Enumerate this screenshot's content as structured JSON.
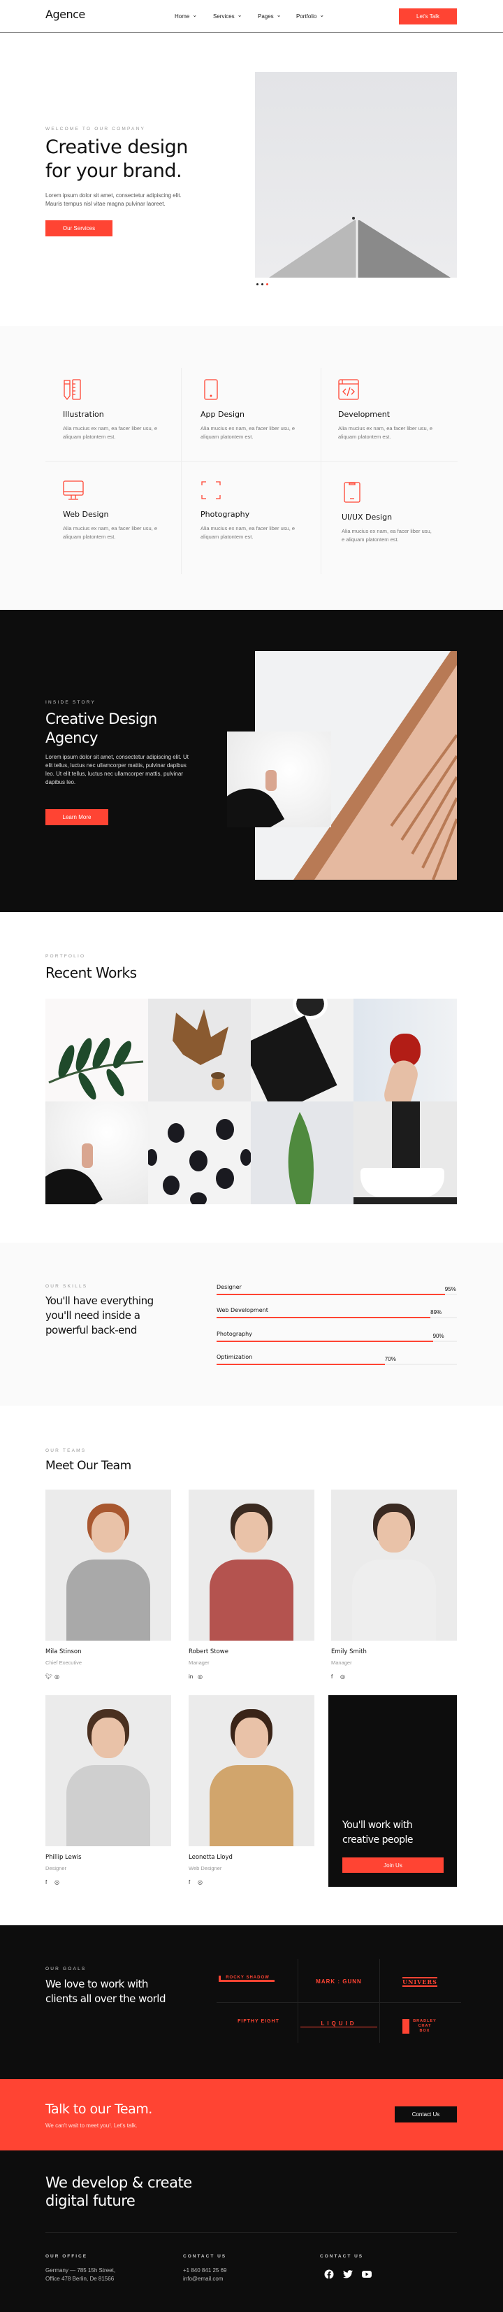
{
  "header": {
    "logo": "Agence",
    "nav": [
      {
        "label": "Home"
      },
      {
        "label": "Services"
      },
      {
        "label": "Pages"
      },
      {
        "label": "Portfolio"
      }
    ],
    "cta": "Let's Talk"
  },
  "hero": {
    "eyebrow": "WELCOME TO OUR COMPANY",
    "title_line1": "Creative design",
    "title_line2": "for your brand.",
    "text_line1": "Lorem ipsum dolor sit amet, consectetur adipiscing elit.",
    "text_line2": "Mauris tempus nisl vitae magna pulvinar laoreet.",
    "button": "Our Services",
    "slider": {
      "slides": 3,
      "active": 3
    }
  },
  "services": [
    {
      "icon": "pencil-ruler-icon",
      "title": "Illustration",
      "desc": "Alia mucius ex nam, ea facer liber usu, e aliquam platontem est."
    },
    {
      "icon": "smartphone-icon",
      "title": "App Design",
      "desc": "Alia mucius ex nam, ea facer liber usu, e aliquam platontem est."
    },
    {
      "icon": "code-window-icon",
      "title": "Development",
      "desc": "Alia mucius ex nam, ea facer liber usu, e aliquam platontem est."
    },
    {
      "icon": "monitor-icon",
      "title": "Web Design",
      "desc": "Alia mucius ex nam, ea facer liber usu, e aliquam platontem est."
    },
    {
      "icon": "focus-frame-icon",
      "title": "Photography",
      "desc": "Alia mucius ex nam, ea facer liber usu, e aliquam platontem est."
    },
    {
      "icon": "mobile-notch-icon",
      "title": "UI/UX Design",
      "desc": "Alia mucius ex nam, ea facer liber usu, e aliquam platontem est."
    }
  ],
  "story": {
    "eyebrow": "INSIDE STORY",
    "title_line1": "Creative Design",
    "title_line2": "Agency",
    "text": "Lorem ipsum dolor sit amet, consectetur adipiscing elit. Ut elit tellus, luctus nec ullamcorper mattis, pulvinar dapibus leo. Ut elit tellus, luctus nec ullamcorper mattis, pulvinar dapibus leo.",
    "button": "Learn More"
  },
  "portfolio": {
    "eyebrow": "PORTFOLIO",
    "title": "Recent Works",
    "items": [
      "green-leaves",
      "autumn-leaf-acorn",
      "black-notebook-2018",
      "red-apple-hand",
      "hand-pen-fur",
      "blackberries",
      "green-leaf",
      "white-bathtub"
    ]
  },
  "skills": {
    "eyebrow": "OUR SKILLS",
    "title_line1": "You'll have everything",
    "title_line2": "you'll need inside a",
    "title_line3": "powerful back-end",
    "items": [
      {
        "label": "Designer",
        "value": 95,
        "text": "95%"
      },
      {
        "label": "Web Development",
        "value": 89,
        "text": "89%"
      },
      {
        "label": "Photography",
        "value": 90,
        "text": "90%"
      },
      {
        "label": "Optimization",
        "value": 70,
        "text": "70%"
      }
    ]
  },
  "team": {
    "eyebrow": "OUR TEAMS",
    "title": "Meet Our Team",
    "members": [
      {
        "name": "Mila Stinson",
        "role": "Chief Executive",
        "socials": [
          "twitter-icon",
          "instagram-icon"
        ]
      },
      {
        "name": "Robert Stowe",
        "role": "Manager",
        "socials": [
          "linkedin-icon",
          "instagram-icon"
        ]
      },
      {
        "name": "Emily Smith",
        "role": "Manager",
        "socials": [
          "facebook-icon",
          "instagram-icon"
        ]
      },
      {
        "name": "Phillip Lewis",
        "role": "Designer",
        "socials": [
          "facebook-icon",
          "instagram-icon"
        ]
      },
      {
        "name": "Leonetta Lloyd",
        "role": "Web Designer",
        "socials": [
          "facebook-icon",
          "instagram-icon"
        ]
      }
    ],
    "join": {
      "title_line1": "You'll work with",
      "title_line2": "creative people",
      "button": "Join Us"
    }
  },
  "clients": {
    "eyebrow": "OUR GOALS",
    "title_line1": "We love to work with",
    "title_line2": "clients all over the world",
    "logos": [
      "ROCKY SHADOW",
      "MARK : GUNN",
      "UNIVERS",
      "FIFTHY EIGHT",
      "LIQUID",
      "BRADLEY CHAT BOX"
    ]
  },
  "cta": {
    "title": "Talk to our Team.",
    "subtitle": "We can't wait to meet you!. Let's talk.",
    "button": "Contact Us"
  },
  "footer": {
    "title_line1": "We develop & create",
    "title_line2": "digital future",
    "office_label": "OUR OFFICE",
    "office_line1": "Germany — 785 15h Street,",
    "office_line2": "Office 478 Berlin, De 81566",
    "contact_label": "CONTACT US",
    "phone": "+1 840 841 25 69",
    "email": "info@email.com",
    "social_label": "CONTACT US",
    "socials": [
      "facebook-icon",
      "twitter-icon",
      "youtube-icon"
    ]
  },
  "colors": {
    "accent": "#ff4433",
    "dark": "#0d0d0d",
    "light_bg": "#fafafa"
  }
}
